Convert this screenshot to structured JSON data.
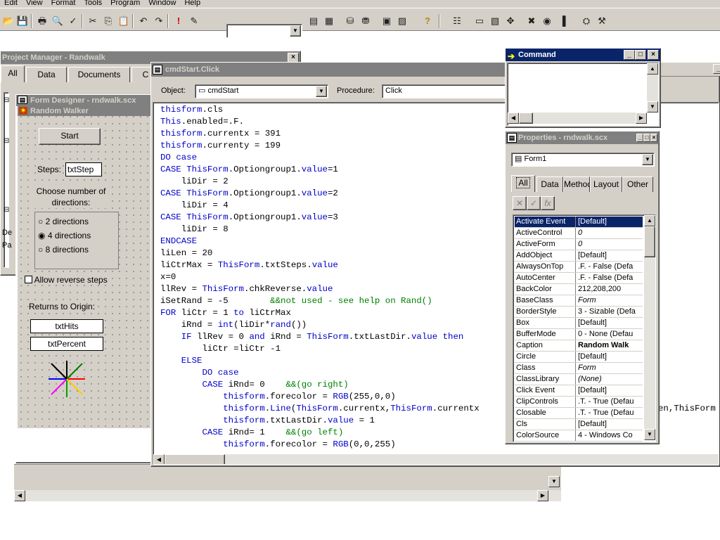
{
  "menu": [
    "Edit",
    "View",
    "Format",
    "Tools",
    "Program",
    "Window",
    "Help"
  ],
  "toolbar": {
    "icons": [
      "open-icon",
      "save-icon",
      "print-icon",
      "print-preview-icon",
      "spell-check-icon",
      "cut-icon",
      "copy-icon",
      "paste-icon",
      "undo-icon",
      "redo-icon",
      "run-icon",
      "modify-form-icon"
    ],
    "icons2": [
      "form-control-icon",
      "grid-icon",
      "database-icon",
      "data-session-icon",
      "report-icon",
      "command-icon",
      "help-icon",
      "layout-icon",
      "form-designer-icon",
      "properties-icon",
      "code-icon",
      "color-palette-icon",
      "form-control-toolbar-icon",
      "help2-icon",
      "wizard-icon",
      "builder-icon"
    ],
    "combo_value": ""
  },
  "project_manager": {
    "title": "Project Manager - Randwalk",
    "tabs": [
      "All",
      "Data",
      "Documents",
      "C"
    ],
    "side_labels": [
      "De",
      "Pa"
    ]
  },
  "form_designer": {
    "title": "Form Designer - rndwalk.scx",
    "form_caption": "Random Walker",
    "start_button": "Start",
    "steps_label": "Steps:",
    "steps_value": "txtStep",
    "choose_label": "Choose number of directions:",
    "options": [
      "2 directions",
      "4 directions",
      "8 directions"
    ],
    "selected_option": 1,
    "allow_reverse": "Allow reverse steps",
    "returns_label": "Returns to Origin:",
    "hits_box": "txtHits",
    "percent_box": "txtPercent"
  },
  "code_window": {
    "title": "cmdStart.Click",
    "object_label": "Object:",
    "object_value": "cmdStart",
    "procedure_label": "Procedure:",
    "procedure_value": "Click",
    "lines": [
      "thisform.cls",
      "This.enabled=.F.",
      "thisform.currentx = 391",
      "thisform.currenty = 199",
      "DO case",
      "CASE ThisForm.Optiongroup1.value=1",
      "    liDir = 2",
      "CASE ThisForm.Optiongroup1.value=2",
      "    liDir = 4",
      "CASE ThisForm.Optiongroup1.value=3",
      "    liDir = 8",
      "ENDCASE",
      "liLen = 20",
      "liCtrMax = ThisForm.txtSteps.value",
      "x=0",
      "llRev = ThisForm.chkReverse.value",
      "iSetRand = -5        &&not used - see help on Rand()",
      "FOR liCtr = 1 to liCtrMax",
      "    iRnd = int(liDir*rand())",
      "    IF llRev = 0 and iRnd = ThisForm.txtLastDir.value then",
      "        liCtr =liCtr -1",
      "    ELSE",
      "        DO case",
      "        CASE iRnd= 0    &&(go right)",
      "            thisform.forecolor = RGB(255,0,0)",
      "            thisform.Line(ThisForm.currentx,ThisForm.currentx,len,ThisForm",
      "            thisform.txtLastDir.value = 1",
      "        CASE iRnd= 1    &&(go left)",
      "            thisform.forecolor = RGB(0,0,255)"
    ],
    "line10_tail": "en,ThisForm"
  },
  "command_window": {
    "title": "Command"
  },
  "properties": {
    "title": "Properties - rndwalk.scx",
    "object_combo": "Form1",
    "tabs": [
      "All",
      "Data",
      "Methods",
      "Layout",
      "Other"
    ],
    "rows": [
      {
        "name": "Activate Event",
        "value": "[Default]",
        "style": ""
      },
      {
        "name": "ActiveControl",
        "value": "0",
        "style": "it"
      },
      {
        "name": "ActiveForm",
        "value": "0",
        "style": "it"
      },
      {
        "name": "AddObject",
        "value": "[Default]",
        "style": ""
      },
      {
        "name": "AlwaysOnTop",
        "value": ".F. - False (Defa",
        "style": ""
      },
      {
        "name": "AutoCenter",
        "value": ".F. - False (Defa",
        "style": ""
      },
      {
        "name": "BackColor",
        "value": "212,208,200",
        "style": ""
      },
      {
        "name": "BaseClass",
        "value": "Form",
        "style": "it"
      },
      {
        "name": "BorderStyle",
        "value": "3 - Sizable (Defa",
        "style": ""
      },
      {
        "name": "Box",
        "value": "[Default]",
        "style": ""
      },
      {
        "name": "BufferMode",
        "value": "0 - None (Defau",
        "style": ""
      },
      {
        "name": "Caption",
        "value": "Random Walk",
        "style": "bd"
      },
      {
        "name": "Circle",
        "value": "[Default]",
        "style": ""
      },
      {
        "name": "Class",
        "value": "Form",
        "style": "it"
      },
      {
        "name": "ClassLibrary",
        "value": "(None)",
        "style": "it"
      },
      {
        "name": "Click Event",
        "value": "[Default]",
        "style": ""
      },
      {
        "name": "ClipControls",
        "value": ".T. - True (Defau",
        "style": ""
      },
      {
        "name": "Closable",
        "value": ".T. - True (Defau",
        "style": ""
      },
      {
        "name": "Cls",
        "value": "[Default]",
        "style": ""
      },
      {
        "name": "ColorSource",
        "value": "4 - Windows Co",
        "style": ""
      }
    ]
  },
  "colors": {
    "active_title": "#0a246a",
    "inactive_title": "#808080",
    "face": "#d4d0c8",
    "keyword": "#0000c8",
    "comment": "#008000"
  }
}
